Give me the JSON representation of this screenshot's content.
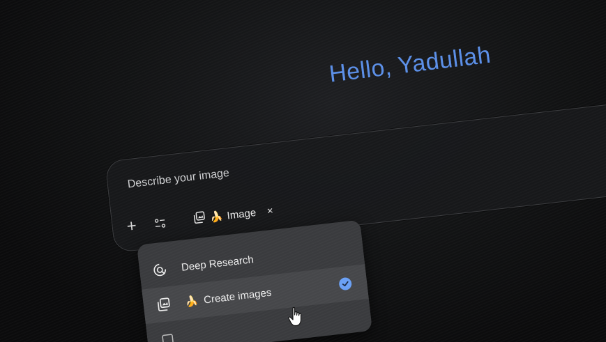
{
  "greeting": {
    "text": "Hello, Yadullah"
  },
  "prompt": {
    "placeholder": "Describe your image",
    "value": "",
    "add_button_icon": "plus-icon",
    "tools_button_icon": "tools-icon",
    "active_chip": {
      "label": "Image",
      "icon": "image-gallery-icon",
      "emoji": "🍌",
      "close_label": "×"
    }
  },
  "menu": {
    "items": [
      {
        "label": "Deep Research",
        "icon": "deep-research-icon",
        "selected": false
      },
      {
        "label": "Create images",
        "icon": "image-gallery-icon",
        "emoji": "🍌",
        "selected": true,
        "check_icon": "check-icon"
      }
    ]
  },
  "colors": {
    "accent": "#5b8fe8",
    "check": "#6aa0f5",
    "menu_bg": "#3a3b3e",
    "background": "#0b0b0c"
  }
}
